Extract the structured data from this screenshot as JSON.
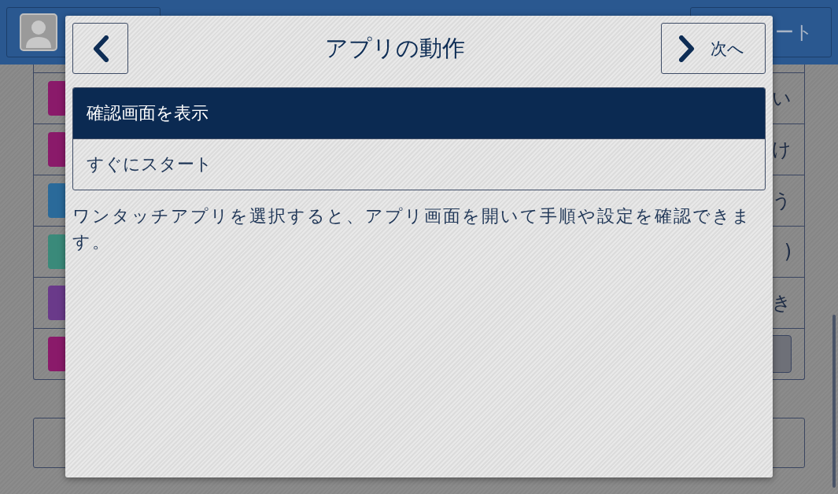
{
  "background": {
    "header": {
      "right_button": "ート"
    },
    "rows": [
      {
        "kind": "text",
        "color": "#8a1a6a",
        "text": "い"
      },
      {
        "kind": "text",
        "color": "#8a1a6a",
        "text": "け"
      },
      {
        "kind": "text",
        "color": "#2a6a9a",
        "text": "う"
      },
      {
        "kind": "text",
        "color": "#3a8a7a",
        "text": ")"
      },
      {
        "kind": "text",
        "color": "#6a3a8a",
        "text": "き"
      },
      {
        "kind": "button",
        "color": "#8a1a6a"
      }
    ]
  },
  "dialog": {
    "title": "アプリの動作",
    "next_button": "次へ",
    "options": [
      {
        "label": "確認画面を表示",
        "selected": true
      },
      {
        "label": "すぐにスタート",
        "selected": false
      }
    ],
    "description": "ワンタッチアプリを選択すると、アプリ画面を開いて手順や設定を確認できます。"
  }
}
